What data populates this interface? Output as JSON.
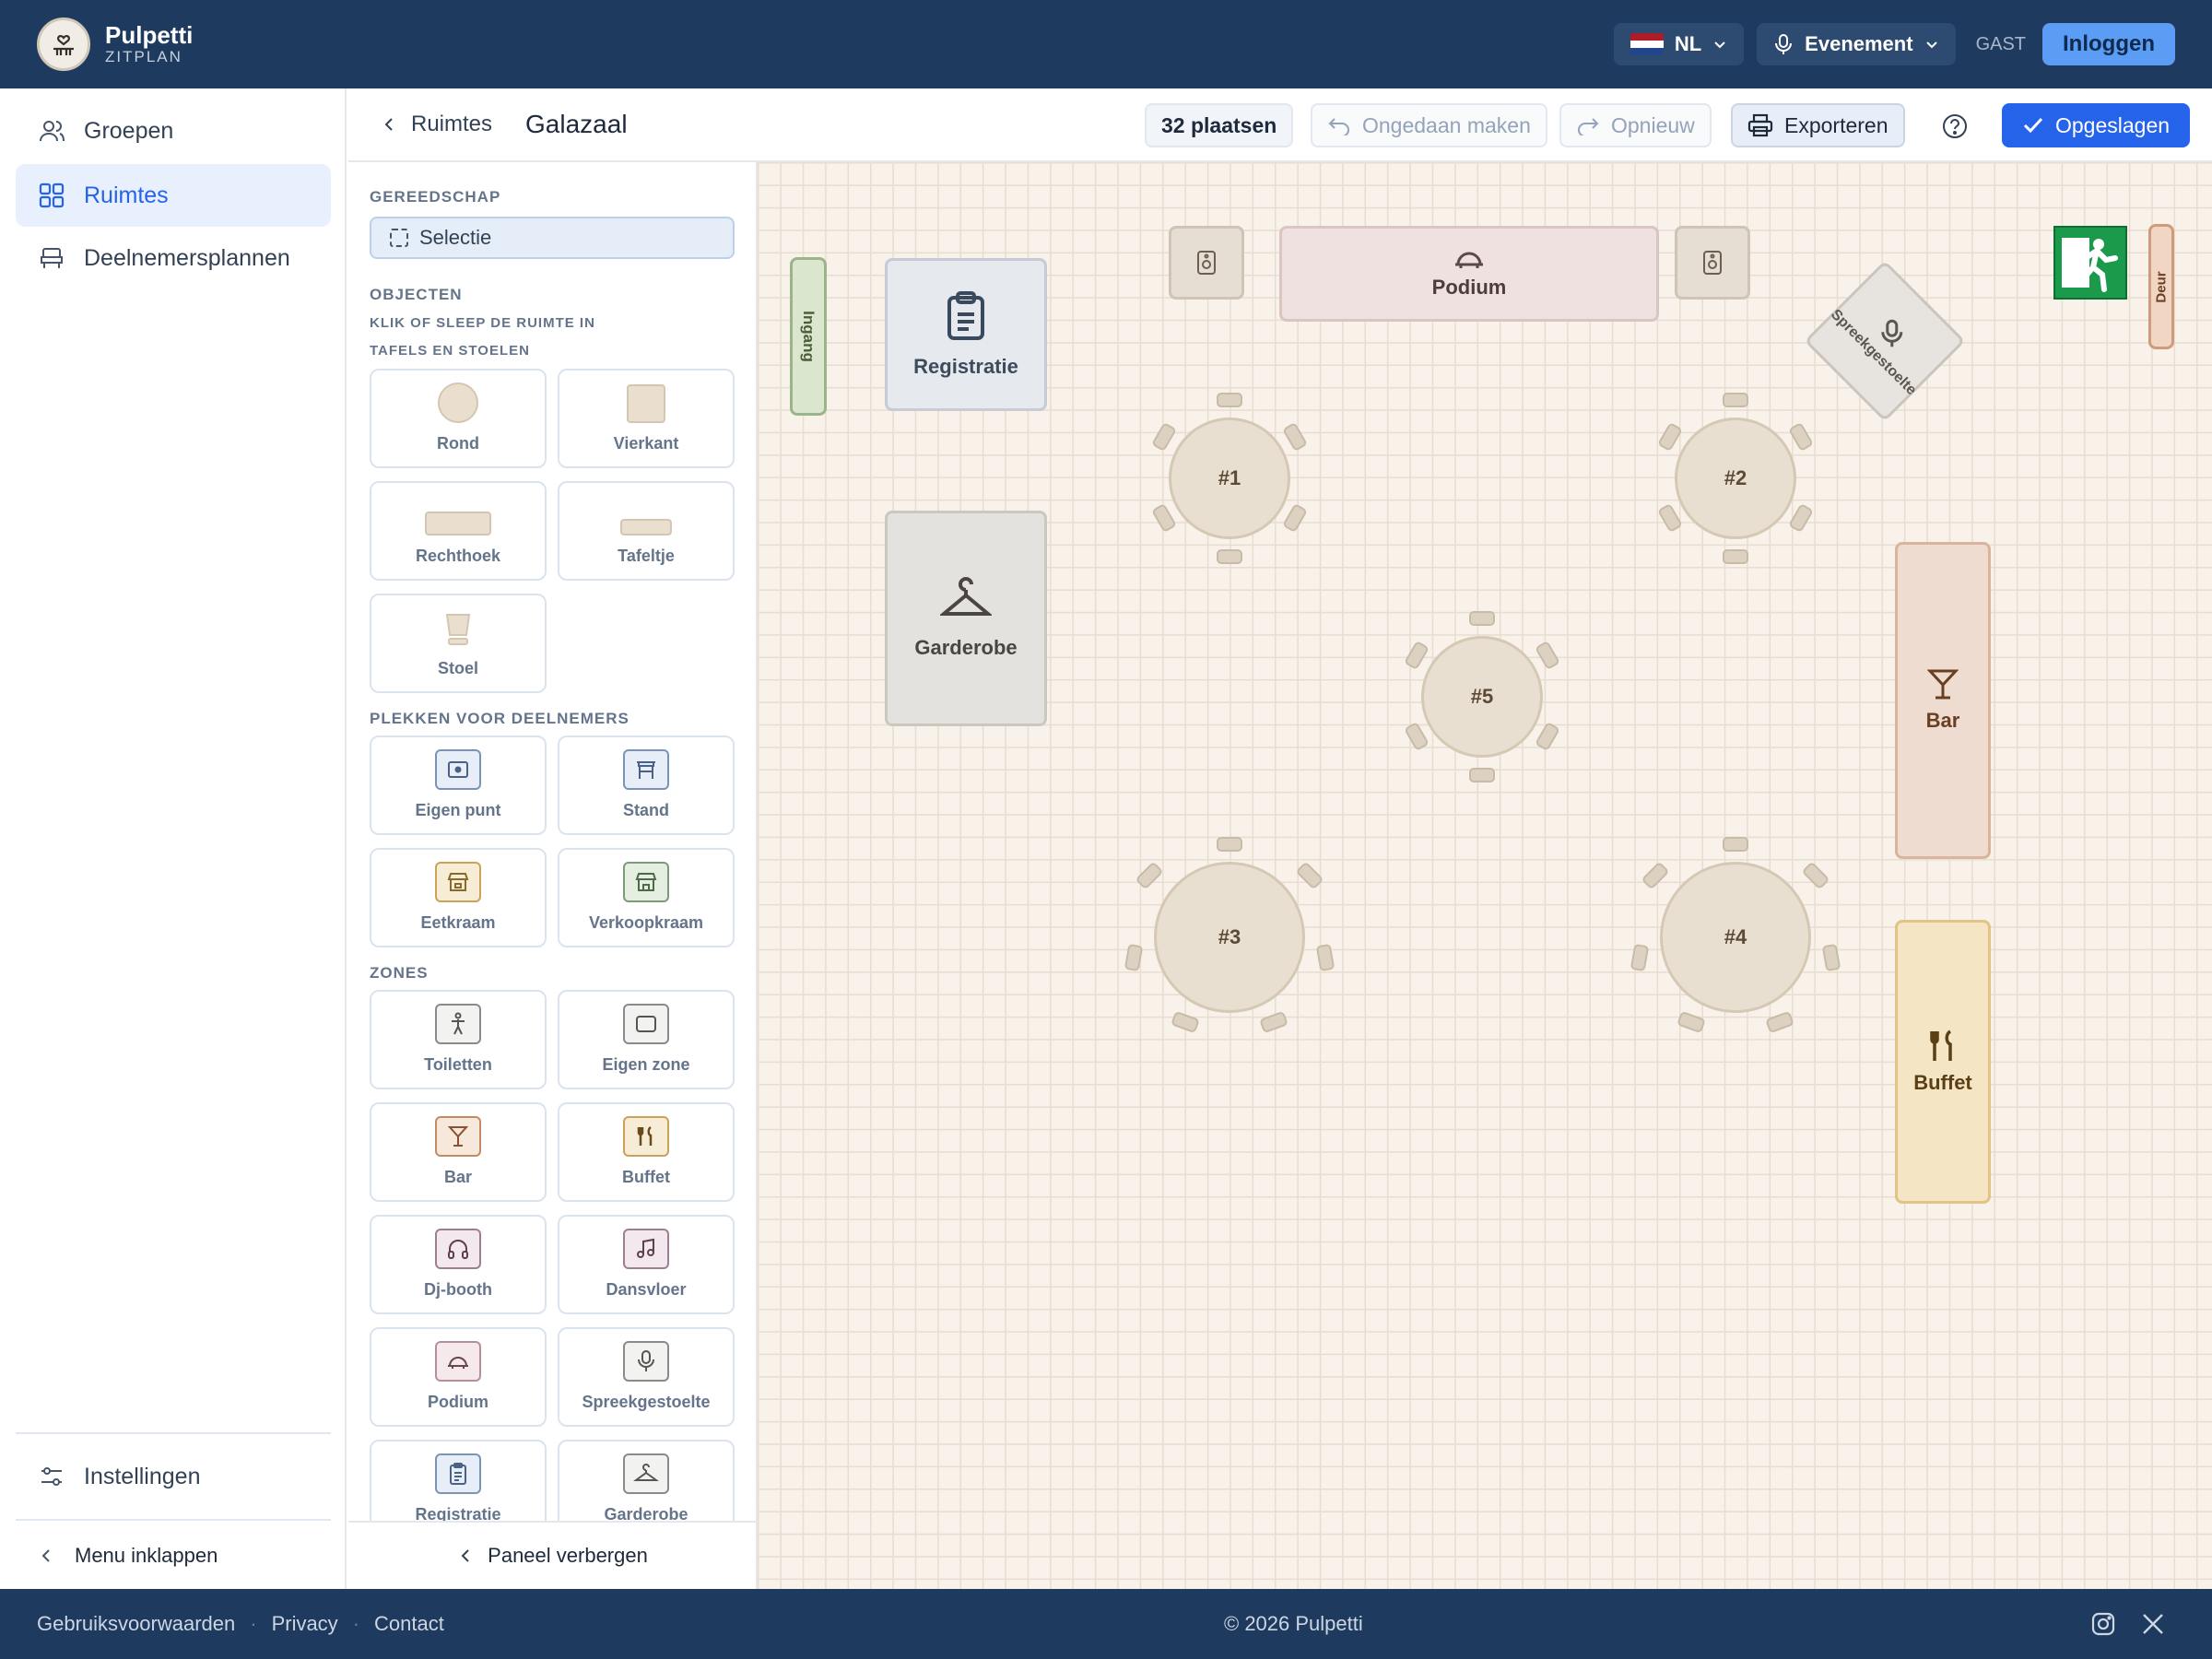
{
  "topbar": {
    "brand": "Pulpetti",
    "sub": "ZITPLAN",
    "language": "NL",
    "mode": "Evenement",
    "guest": "GAST",
    "login": "Inloggen"
  },
  "sidebar": {
    "items": [
      {
        "label": "Groepen",
        "icon": "users-icon"
      },
      {
        "label": "Ruimtes",
        "icon": "grid-icon"
      },
      {
        "label": "Deelnemersplannen",
        "icon": "seat-icon"
      }
    ],
    "settings": "Instellingen",
    "collapse": "Menu inklappen"
  },
  "header": {
    "back": "Ruimtes",
    "room": "Galazaal",
    "seats": "32 plaatsen",
    "undo": "Ongedaan maken",
    "redo": "Opnieuw",
    "export": "Exporteren",
    "saved": "Opgeslagen"
  },
  "panel": {
    "tools_title": "GEREEDSCHAP",
    "select": "Selectie",
    "objects_title": "OBJECTEN",
    "objects_hint": "KLIK OF SLEEP DE RUIMTE IN",
    "tables_title": "TAFELS EN STOELEN",
    "tables": [
      "Rond",
      "Vierkant",
      "Rechthoek",
      "Tafeltje",
      "Stoel"
    ],
    "places_title": "PLEKKEN VOOR DEELNEMERS",
    "places": [
      "Eigen punt",
      "Stand",
      "Eetkraam",
      "Verkoopkraam"
    ],
    "zones_title": "ZONES",
    "zones": [
      "Toiletten",
      "Eigen zone",
      "Bar",
      "Buffet",
      "Dj-booth",
      "Dansvloer",
      "Podium",
      "Spreekgestoelte",
      "Registratie",
      "Garderobe"
    ],
    "hide": "Paneel verbergen"
  },
  "canvas": {
    "entrance": "Ingang",
    "registration": "Registratie",
    "cloakroom": "Garderobe",
    "stage": "Podium",
    "lectern": "Spreekgestoelte",
    "door": "Deur",
    "bar": "Bar",
    "buffet": "Buffet",
    "tables": [
      "#1",
      "#2",
      "#5",
      "#3",
      "#4"
    ]
  },
  "footer": {
    "terms": "Gebruiksvoorwaarden",
    "privacy": "Privacy",
    "contact": "Contact",
    "copyright": "© 2026 Pulpetti"
  },
  "colors": {
    "topbar": "#1f3a5f",
    "accent": "#2563eb",
    "canvas": "#f8f2ea"
  }
}
